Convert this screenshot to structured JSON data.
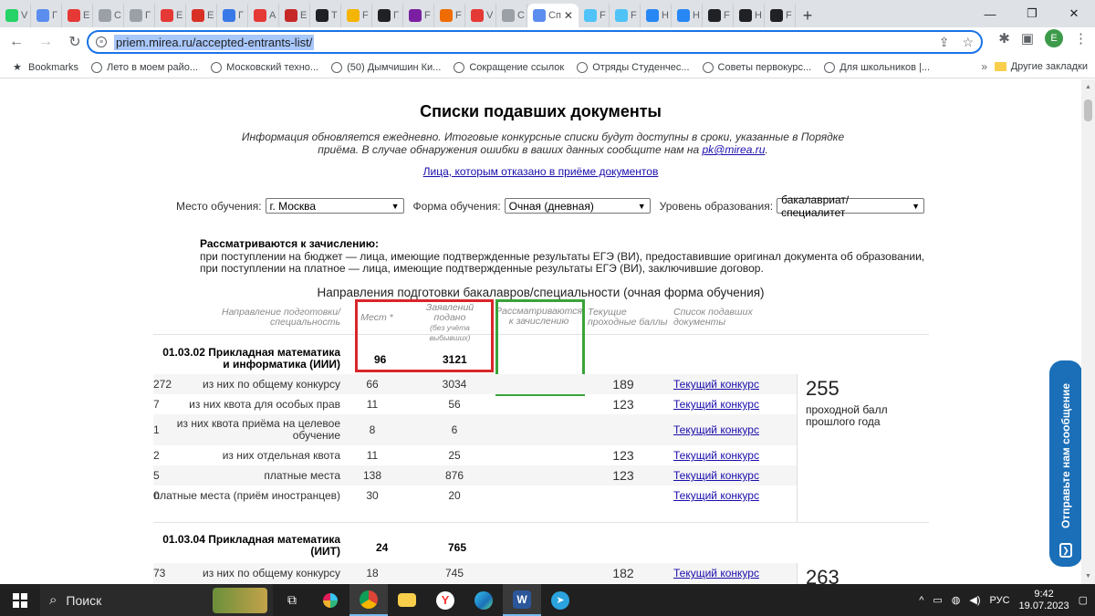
{
  "browser": {
    "tabs": [
      {
        "label": "V",
        "color": "#25d366"
      },
      {
        "label": "Г",
        "color": "#5b8def"
      },
      {
        "label": "E",
        "color": "#e53935"
      },
      {
        "label": "C",
        "color": "#9aa0a6"
      },
      {
        "label": "Г",
        "color": "#9aa0a6"
      },
      {
        "label": "E",
        "color": "#e53935"
      },
      {
        "label": "E",
        "color": "#d93025"
      },
      {
        "label": "Г",
        "color": "#3b78e7"
      },
      {
        "label": "A",
        "color": "#e53935"
      },
      {
        "label": "E",
        "color": "#c62828"
      },
      {
        "label": "T",
        "color": "#202124"
      },
      {
        "label": "F",
        "color": "#f4b400"
      },
      {
        "label": "Г",
        "color": "#202124"
      },
      {
        "label": "F",
        "color": "#7b1fa2"
      },
      {
        "label": "F",
        "color": "#ef6c00"
      },
      {
        "label": "V",
        "color": "#e53935"
      },
      {
        "label": "C",
        "color": "#9aa0a6"
      }
    ],
    "active_tab": {
      "label": "Сп",
      "close": "✕"
    },
    "tabs_after": [
      {
        "label": "F",
        "color": "#4fc3f7"
      },
      {
        "label": "F",
        "color": "#4fc3f7"
      },
      {
        "label": "H",
        "color": "#2787f5"
      },
      {
        "label": "H",
        "color": "#2787f5"
      },
      {
        "label": "F",
        "color": "#202124"
      },
      {
        "label": "H",
        "color": "#202124"
      },
      {
        "label": "F",
        "color": "#202124"
      }
    ],
    "new_tab": "+",
    "window_controls": {
      "minimize": "—",
      "restore": "❐",
      "close": "✕"
    },
    "url": "priem.mirea.ru/accepted-entrants-list/",
    "profile_initial": "E",
    "bookmarks": [
      "Bookmarks",
      "Лето в моем райо...",
      "Московский техно...",
      "(50) Дымчишин Ки...",
      "Сокращение ссылок",
      "Отряды Студенчес...",
      "Советы первокурс...",
      "Для школьников |..."
    ],
    "bookmarks_more": "»",
    "other_bookmarks": "Другие закладки"
  },
  "page": {
    "title": "Списки подавших документы",
    "info_text": "Информация обновляется ежедневно. Итоговые конкурсные списки будут доступны в сроки, указанные в Порядке приёма. В случае обнаружения ошибки в ваших данных сообщите нам на",
    "info_email": "pk@mirea.ru",
    "info_end": ".",
    "refused_link": "Лица, которым отказано в приёме документов",
    "filters": {
      "place_label": "Место обучения:",
      "place_value": "г. Москва",
      "form_label": "Форма обучения:",
      "form_value": "Очная (дневная)",
      "level_label": "Уровень образования:",
      "level_value": "бакалавриат/специалитет"
    },
    "rules": {
      "heading": "Рассматриваются к зачислению:",
      "line1": "при поступлении на бюджет — лица, имеющие подтвержденные результаты ЕГЭ (ВИ), предоставившие оригинал документа об образовании,",
      "line2": "при поступлении на платное — лица, имеющие подтвержденные результаты ЕГЭ (ВИ), заключившие договор."
    },
    "section_title": "Направления подготовки бакалавров/специальности (очная форма обучения)",
    "headers": {
      "direction": "Направление подготовки/ специальность",
      "places": "Мест *",
      "applications": "Заявлений подано",
      "applications_note": "(без учёта выбывших)",
      "considered": "Рассматриваются к зачислению",
      "scores": "Текущие проходные баллы",
      "list": "Список подавших документы"
    },
    "programs": [
      {
        "name": "01.03.02 Прикладная математика и информатика (ИИИ)",
        "places": "96",
        "applications": "3121",
        "rows": [
          {
            "name": "из них по общему конкурсу",
            "places": "66",
            "apps": "3034",
            "considered": "272",
            "score": "189",
            "link": "Текущий конкурс"
          },
          {
            "name": "из них квота для особых прав",
            "places": "11",
            "apps": "56",
            "considered": "7",
            "score": "123",
            "link": "Текущий конкурс"
          },
          {
            "name": "из них квота приёма на целевое обучение",
            "places": "8",
            "apps": "6",
            "considered": "1",
            "score": "",
            "link": "Текущий конкурс"
          },
          {
            "name": "из них отдельная квота",
            "places": "11",
            "apps": "25",
            "considered": "2",
            "score": "123",
            "link": "Текущий конкурс"
          },
          {
            "name": "платные места",
            "places": "138",
            "apps": "876",
            "considered": "5",
            "score": "123",
            "link": "Текущий конкурс"
          },
          {
            "name": "платные места (приём иностранцев)",
            "places": "30",
            "apps": "20",
            "considered": "0",
            "score": "",
            "link": "Текущий конкурс"
          }
        ],
        "last_year_score": "255",
        "last_year_label": "проходной балл прошлого года"
      },
      {
        "name": "01.03.04 Прикладная математика (ИИТ)",
        "places": "24",
        "applications": "765",
        "rows": [
          {
            "name": "из них по общему конкурсу",
            "places": "18",
            "apps": "745",
            "considered": "73",
            "score": "182",
            "link": "Текущий конкурс"
          }
        ],
        "last_year_score": "263"
      }
    ],
    "feedback": "Отправьте нам сообщение"
  },
  "taskbar": {
    "search": "Поиск",
    "lang": "РУС",
    "time": "9:42",
    "date": "19.07.2023",
    "tray_arrow": "^"
  }
}
